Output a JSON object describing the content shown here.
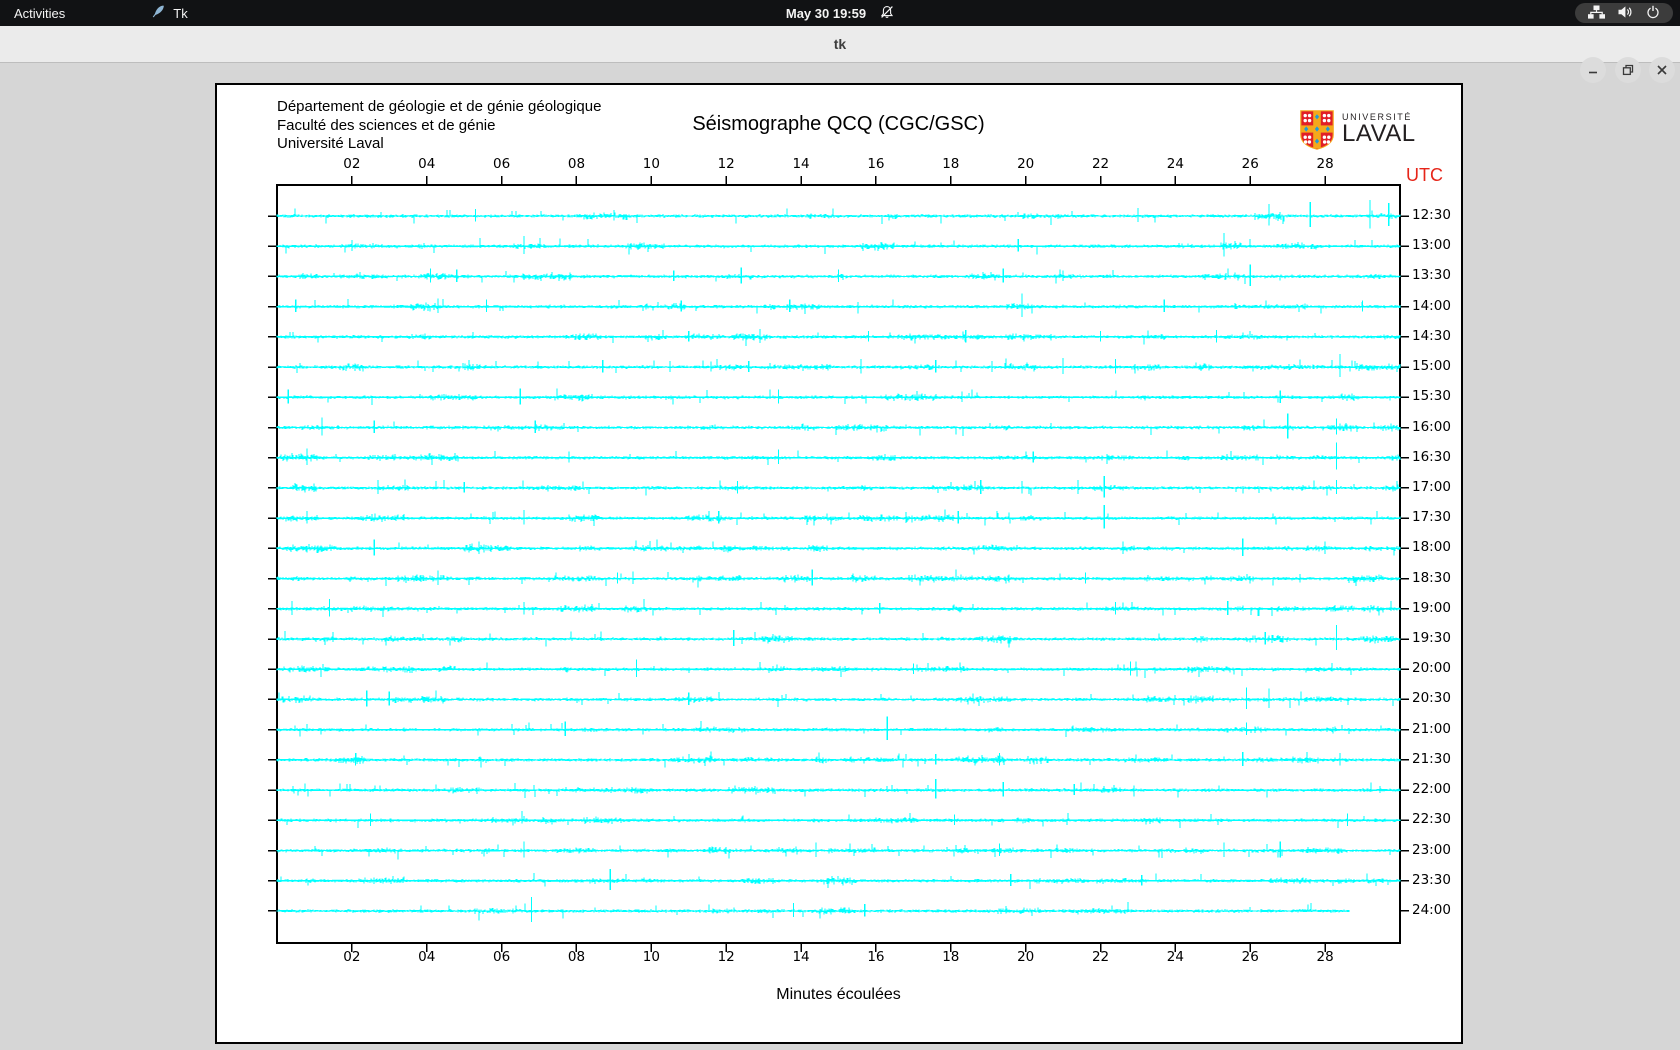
{
  "top_bar": {
    "activities": "Activities",
    "app_name": "Tk",
    "clock": "May 30 19:59",
    "icons": [
      "tk-feather-icon",
      "bell-muted-icon",
      "network-wired-icon",
      "volume-icon",
      "power-icon"
    ]
  },
  "window": {
    "title": "tk",
    "controls": [
      "minimize",
      "restore",
      "close"
    ]
  },
  "figure": {
    "header_lines": [
      "Département de géologie et de génie géologique",
      "Faculté des sciences et de génie",
      "Université Laval"
    ],
    "title": "Séismographe QCQ (CGC/GSC)",
    "logo": {
      "line1": "UNIVERSITÉ",
      "line2": "LAVAL"
    },
    "logo_colors": {
      "shield": "#e11f26",
      "cross": "#f5a81c",
      "dots": "#ffffff",
      "cross_dots": "#1f9cd8"
    },
    "utc_label": "UTC",
    "x_axis_label": "Minutes écoulées"
  },
  "chart_data": {
    "type": "line",
    "subtype": "seismograph-helicorder",
    "title": "Séismographe QCQ (CGC/GSC)",
    "xlabel": "Minutes écoulées",
    "ylabel": "UTC",
    "trace_color": "#00ffff",
    "axis_color": "#000000",
    "x_range_minutes": [
      0,
      30
    ],
    "x_ticks": [
      "02",
      "04",
      "06",
      "08",
      "10",
      "12",
      "14",
      "16",
      "18",
      "20",
      "22",
      "24",
      "26",
      "28"
    ],
    "x_tick_minutes": [
      2,
      4,
      6,
      8,
      10,
      12,
      14,
      16,
      18,
      20,
      22,
      24,
      26,
      28
    ],
    "y_axis_side": "right",
    "traces": [
      {
        "label": "12:30",
        "end_fraction": 1,
        "spikes": [
          [
            5.3,
            7
          ],
          [
            9.0,
            6
          ],
          [
            23.0,
            8
          ],
          [
            26.5,
            12
          ],
          [
            27.6,
            14
          ],
          [
            29.2,
            16
          ],
          [
            29.7,
            13
          ]
        ]
      },
      {
        "label": "13:00",
        "end_fraction": 1,
        "spikes": [
          [
            2.0,
            6
          ],
          [
            6.6,
            10
          ],
          [
            19.8,
            7
          ],
          [
            25.3,
            13
          ]
        ]
      },
      {
        "label": "13:30",
        "end_fraction": 1,
        "spikes": [
          [
            4.1,
            8
          ],
          [
            4.8,
            7
          ],
          [
            10.6,
            6
          ],
          [
            12.4,
            9
          ],
          [
            15.0,
            7
          ],
          [
            19.4,
            8
          ],
          [
            21.0,
            6
          ],
          [
            26.0,
            12
          ]
        ]
      },
      {
        "label": "14:00",
        "end_fraction": 1,
        "spikes": [
          [
            0.5,
            7
          ],
          [
            4.3,
            8
          ],
          [
            5.6,
            7
          ],
          [
            10.8,
            6
          ],
          [
            13.7,
            7
          ],
          [
            19.9,
            13
          ],
          [
            23.7,
            7
          ],
          [
            29.0,
            6
          ]
        ]
      },
      {
        "label": "14:30",
        "end_fraction": 1,
        "spikes": [
          [
            11.0,
            6
          ],
          [
            12.9,
            8
          ],
          [
            15.8,
            6
          ],
          [
            18.4,
            7
          ],
          [
            22.0,
            6
          ],
          [
            25.1,
            7
          ]
        ]
      },
      {
        "label": "15:00",
        "end_fraction": 1,
        "spikes": [
          [
            8.7,
            7
          ],
          [
            10.5,
            6
          ],
          [
            12.6,
            6
          ],
          [
            15.6,
            8
          ],
          [
            17.6,
            7
          ],
          [
            19.1,
            6
          ],
          [
            21.0,
            9
          ],
          [
            22.4,
            8
          ],
          [
            28.4,
            13
          ]
        ]
      },
      {
        "label": "15:30",
        "end_fraction": 1,
        "spikes": [
          [
            0.3,
            8
          ],
          [
            6.5,
            9
          ],
          [
            13.4,
            8
          ],
          [
            18.3,
            6
          ],
          [
            26.8,
            7
          ]
        ]
      },
      {
        "label": "16:00",
        "end_fraction": 1,
        "spikes": [
          [
            1.2,
            10
          ],
          [
            2.6,
            7
          ],
          [
            6.9,
            7
          ],
          [
            27.0,
            14
          ],
          [
            28.3,
            9
          ]
        ]
      },
      {
        "label": "16:30",
        "end_fraction": 1,
        "spikes": [
          [
            0.8,
            9
          ],
          [
            7.8,
            6
          ],
          [
            13.4,
            8
          ],
          [
            20.2,
            6
          ],
          [
            28.3,
            15
          ]
        ]
      },
      {
        "label": "17:00",
        "end_fraction": 1,
        "spikes": [
          [
            2.7,
            8
          ],
          [
            5.0,
            6
          ],
          [
            12.3,
            7
          ],
          [
            18.8,
            8
          ],
          [
            19.9,
            7
          ],
          [
            21.4,
            8
          ],
          [
            22.1,
            12
          ],
          [
            28.3,
            8
          ]
        ]
      },
      {
        "label": "17:30",
        "end_fraction": 1,
        "spikes": [
          [
            0.8,
            7
          ],
          [
            6.6,
            8
          ],
          [
            11.8,
            7
          ],
          [
            16.8,
            6
          ],
          [
            18.2,
            7
          ],
          [
            22.1,
            13
          ]
        ]
      },
      {
        "label": "18:00",
        "end_fraction": 1,
        "spikes": [
          [
            2.6,
            9
          ],
          [
            5.4,
            7
          ],
          [
            22.6,
            7
          ],
          [
            25.8,
            10
          ],
          [
            28.0,
            7
          ]
        ]
      },
      {
        "label": "18:30",
        "end_fraction": 1,
        "spikes": [
          [
            4.3,
            8
          ],
          [
            9.1,
            6
          ],
          [
            14.3,
            9
          ],
          [
            21.6,
            6
          ]
        ]
      },
      {
        "label": "19:00",
        "end_fraction": 1,
        "spikes": [
          [
            0.4,
            8
          ],
          [
            1.4,
            10
          ],
          [
            6.6,
            7
          ],
          [
            16.1,
            6
          ],
          [
            22.4,
            7
          ],
          [
            25.4,
            8
          ]
        ]
      },
      {
        "label": "19:30",
        "end_fraction": 1,
        "spikes": [
          [
            12.2,
            9
          ],
          [
            26.4,
            7
          ],
          [
            28.3,
            14
          ]
        ]
      },
      {
        "label": "20:00",
        "end_fraction": 1,
        "spikes": [
          [
            9.6,
            10
          ],
          [
            17.0,
            6
          ],
          [
            22.8,
            8
          ]
        ]
      },
      {
        "label": "20:30",
        "end_fraction": 1,
        "spikes": [
          [
            2.4,
            9
          ],
          [
            3.0,
            8
          ],
          [
            11.0,
            7
          ],
          [
            25.9,
            12
          ],
          [
            26.5,
            11
          ]
        ]
      },
      {
        "label": "21:00",
        "end_fraction": 1,
        "spikes": [
          [
            7.7,
            8
          ],
          [
            16.3,
            13
          ],
          [
            25.9,
            7
          ]
        ]
      },
      {
        "label": "21:30",
        "end_fraction": 1,
        "spikes": [
          [
            2.1,
            7
          ],
          [
            17.6,
            6
          ],
          [
            19.3,
            7
          ],
          [
            25.8,
            8
          ],
          [
            28.4,
            7
          ]
        ]
      },
      {
        "label": "22:00",
        "end_fraction": 1,
        "spikes": [
          [
            17.6,
            11
          ],
          [
            19.4,
            8
          ],
          [
            21.3,
            6
          ]
        ]
      },
      {
        "label": "22:30",
        "end_fraction": 1,
        "spikes": [
          [
            2.5,
            7
          ],
          [
            18.1,
            6
          ],
          [
            28.6,
            7
          ]
        ]
      },
      {
        "label": "23:00",
        "end_fraction": 1,
        "spikes": [
          [
            6.6,
            9
          ],
          [
            14.4,
            8
          ],
          [
            19.3,
            7
          ],
          [
            25.3,
            8
          ],
          [
            26.8,
            9
          ]
        ]
      },
      {
        "label": "23:30",
        "end_fraction": 1,
        "spikes": [
          [
            8.9,
            12
          ],
          [
            19.6,
            7
          ],
          [
            23.1,
            6
          ]
        ]
      },
      {
        "label": "24:00",
        "end_fraction": 0.955,
        "spikes": [
          [
            6.8,
            14
          ],
          [
            13.8,
            8
          ],
          [
            15.7,
            7
          ]
        ]
      }
    ]
  }
}
